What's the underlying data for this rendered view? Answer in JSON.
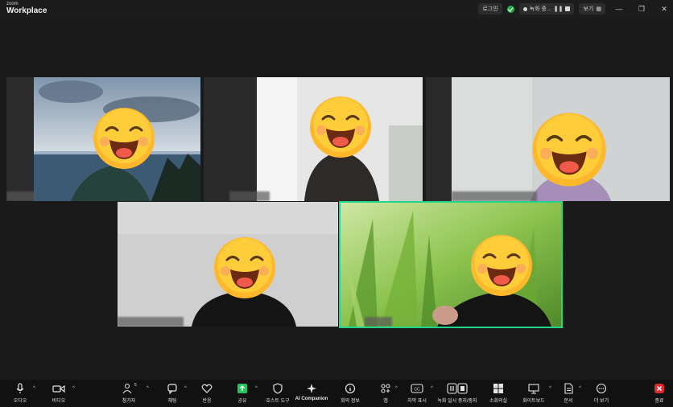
{
  "app": {
    "brand_top": "zoom",
    "brand": "Workplace"
  },
  "titlebar": {
    "login": "로그인",
    "recording": "녹화 중...",
    "view": "보기",
    "minimize": "—",
    "restore": "❐",
    "close": "✕"
  },
  "toolbar": {
    "audio": "오디오",
    "video": "비디오",
    "participants": "참가자",
    "participants_count": "5",
    "chat": "채팅",
    "react": "반응",
    "share": "공유",
    "host_tools": "호스트 도구",
    "ai_companion": "AI Companion",
    "meeting_info": "회의 정보",
    "apps": "앱",
    "captions": "자막 표시",
    "record_control": "녹화 일시 중지/중지",
    "breakout": "소회의실",
    "whiteboard": "화이트보드",
    "notes": "문서",
    "more": "더 보기",
    "end": "종료"
  },
  "colors": {
    "active_speaker": "#22d38a",
    "share_green": "#21c45d",
    "end_red": "#e02b2b",
    "shield_green": "#23b14d"
  }
}
